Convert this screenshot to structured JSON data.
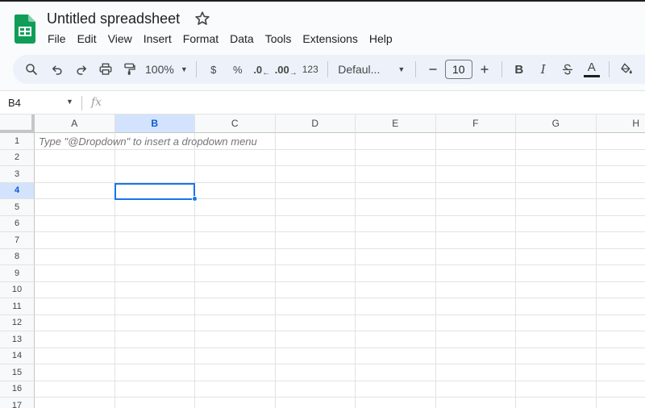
{
  "doc": {
    "title": "Untitled spreadsheet"
  },
  "menu": [
    "File",
    "Edit",
    "View",
    "Insert",
    "Format",
    "Data",
    "Tools",
    "Extensions",
    "Help"
  ],
  "toolbar": {
    "zoom": "100%",
    "currency": "$",
    "percent": "%",
    "decrease_decimal": ".0",
    "increase_decimal": ".00",
    "number_format": "123",
    "font": "Defaul...",
    "font_size": "10",
    "bold": "B",
    "italic": "I",
    "text_color_glyph": "A"
  },
  "formula_bar": {
    "name_box": "B4",
    "fx": "fx"
  },
  "grid": {
    "columns": [
      "A",
      "B",
      "C",
      "D",
      "E",
      "F",
      "G",
      "H"
    ],
    "rows": [
      "1",
      "2",
      "3",
      "4",
      "5",
      "6",
      "7",
      "8",
      "9",
      "10",
      "11",
      "12",
      "13",
      "14",
      "15",
      "16",
      "17"
    ],
    "selected_column": "B",
    "selected_row": "4",
    "hint_text": "Type \"@Dropdown\"  to insert a dropdown menu"
  },
  "colors": {
    "accent": "#1a73e8",
    "logo_green": "#0f9d58",
    "selected_header_bg": "#d3e3fd"
  }
}
